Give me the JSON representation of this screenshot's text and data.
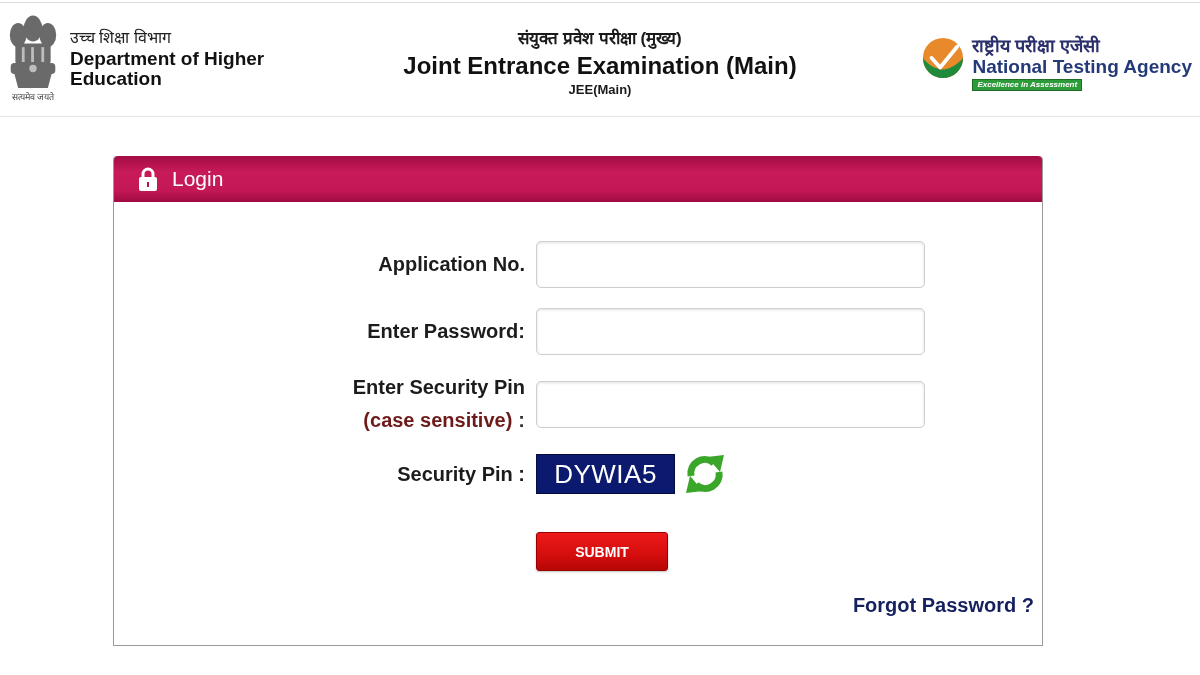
{
  "header": {
    "left": {
      "motto": "सत्यमेव जयते",
      "title_hindi": "उच्च शिक्षा विभाग",
      "title": "Department of Higher Education"
    },
    "center": {
      "title_hindi": "संयुक्त प्रवेश परीक्षा (मुख्य)",
      "title": "Joint Entrance Examination (Main)",
      "subtitle": "JEE(Main)"
    },
    "right": {
      "title_hindi": "राष्ट्रीय परीक्षा एजेंसी",
      "title": "National Testing Agency",
      "tagline": "Excellence in Assessment"
    }
  },
  "login": {
    "title": "Login",
    "fields": [
      {
        "label": "Application No."
      },
      {
        "label": "Enter Password:"
      },
      {
        "label": "Enter Security Pin",
        "note": "(case sensitive)",
        "suffix": ":"
      }
    ],
    "captcha": {
      "label": "Security Pin :",
      "code": "DYWIA5"
    },
    "submit": "SUBMIT",
    "forgot_link": "Forgot Password ?"
  }
}
